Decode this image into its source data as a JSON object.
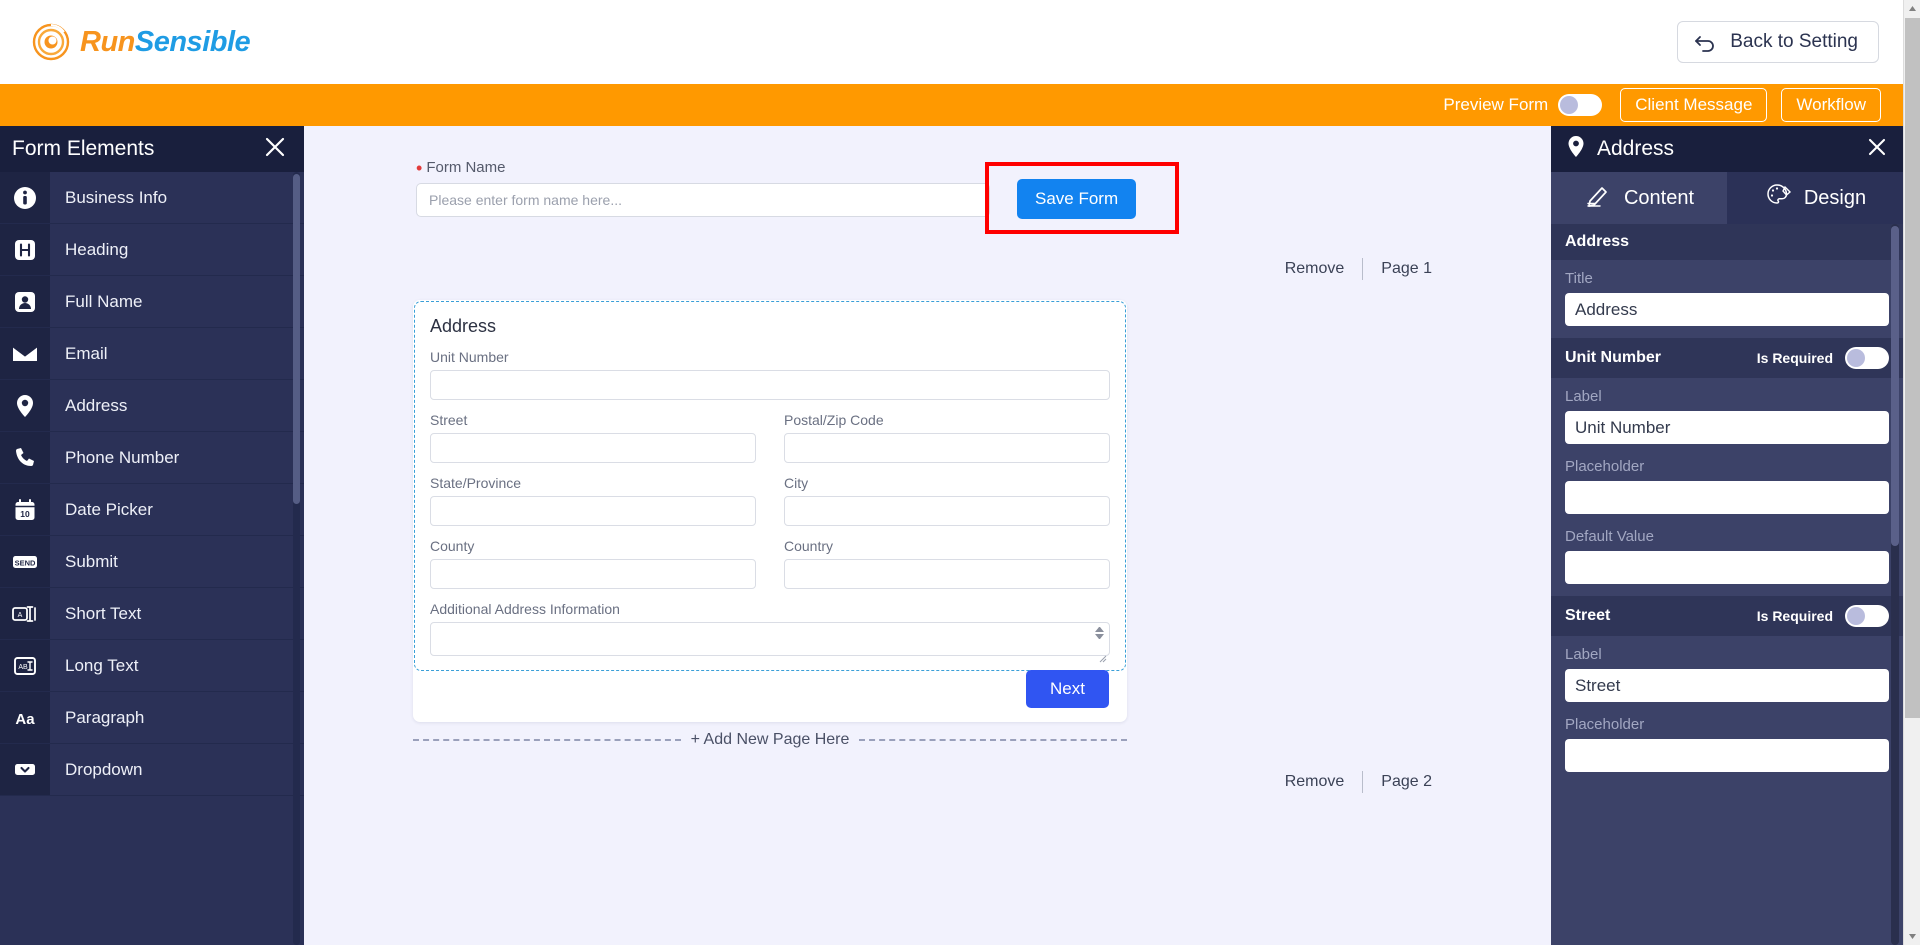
{
  "brand": {
    "name_part1": "Run",
    "name_part2": "Sensible",
    "logo_icon": "sun-circle-icon",
    "orange": "#f7941e",
    "blue": "#1f9ce4"
  },
  "topbar": {
    "back_button": "Back to Setting",
    "back_icon": "undo-arrow-icon"
  },
  "orangebar": {
    "preview_label": "Preview Form",
    "preview_toggle_state": "off",
    "client_message": "Client Message",
    "workflow": "Workflow",
    "background": "#ff9900"
  },
  "sidebar": {
    "title": "Form Elements",
    "close_icon": "close-icon",
    "items": [
      {
        "label": "Business Info",
        "icon": "info-circle-icon"
      },
      {
        "label": "Heading",
        "icon": "heading-h-icon"
      },
      {
        "label": "Full Name",
        "icon": "person-badge-icon"
      },
      {
        "label": "Email",
        "icon": "envelope-icon"
      },
      {
        "label": "Address",
        "icon": "location-pin-icon"
      },
      {
        "label": "Phone Number",
        "icon": "phone-icon"
      },
      {
        "label": "Date Picker",
        "icon": "calendar-10-icon"
      },
      {
        "label": "Submit",
        "icon": "send-icon"
      },
      {
        "label": "Short Text",
        "icon": "short-text-icon"
      },
      {
        "label": "Long Text",
        "icon": "long-text-icon"
      },
      {
        "label": "Paragraph",
        "icon": "paragraph-aa-icon"
      },
      {
        "label": "Dropdown",
        "icon": "dropdown-chevron-icon"
      }
    ]
  },
  "canvas": {
    "form_name_label": "Form Name",
    "form_name_required_marker": "•",
    "form_name_value": "",
    "form_name_placeholder": "Please enter form name here...",
    "save_button": "Save Form",
    "save_button_color": "#1283f0",
    "annotation_box_color": "#ff0000",
    "page_controls": {
      "remove": "Remove",
      "page": "Page 1"
    },
    "page_controls_bottom": {
      "remove": "Remove",
      "page": "Page 2"
    },
    "address_block": {
      "title": "Address",
      "fields_full_top": {
        "label": "Unit Number",
        "value": ""
      },
      "rows": [
        [
          {
            "label": "Street",
            "value": ""
          },
          {
            "label": "Postal/Zip Code",
            "value": ""
          }
        ],
        [
          {
            "label": "State/Province",
            "value": ""
          },
          {
            "label": "City",
            "value": ""
          }
        ],
        [
          {
            "label": "County",
            "value": ""
          },
          {
            "label": "Country",
            "value": ""
          }
        ]
      ],
      "textarea_field": {
        "label": "Additional Address Information",
        "value": ""
      }
    },
    "next_button": "Next",
    "next_button_color": "#3055f2",
    "add_new_page": "+ Add New Page Here"
  },
  "right_panel": {
    "header_title": "Address",
    "header_icon": "location-pin-icon",
    "close_icon": "close-icon",
    "tabs": [
      {
        "label": "Content",
        "icon": "pencil-edit-icon",
        "active": true
      },
      {
        "label": "Design",
        "icon": "palette-icon",
        "active": false
      }
    ],
    "sections": [
      {
        "name": "Address",
        "has_required_toggle": false,
        "required_label": "",
        "required_state": "",
        "fields": [
          {
            "label": "Title",
            "value": "Address",
            "placeholder": ""
          }
        ]
      },
      {
        "name": "Unit Number",
        "has_required_toggle": true,
        "required_label": "Is Required",
        "required_state": "off",
        "fields": [
          {
            "label": "Label",
            "value": "Unit Number",
            "placeholder": ""
          },
          {
            "label": "Placeholder",
            "value": "",
            "placeholder": ""
          },
          {
            "label": "Default Value",
            "value": "",
            "placeholder": ""
          }
        ]
      },
      {
        "name": "Street",
        "has_required_toggle": true,
        "required_label": "Is Required",
        "required_state": "off",
        "fields": [
          {
            "label": "Label",
            "value": "Street",
            "placeholder": ""
          },
          {
            "label": "Placeholder",
            "value": "",
            "placeholder": ""
          }
        ]
      }
    ]
  }
}
